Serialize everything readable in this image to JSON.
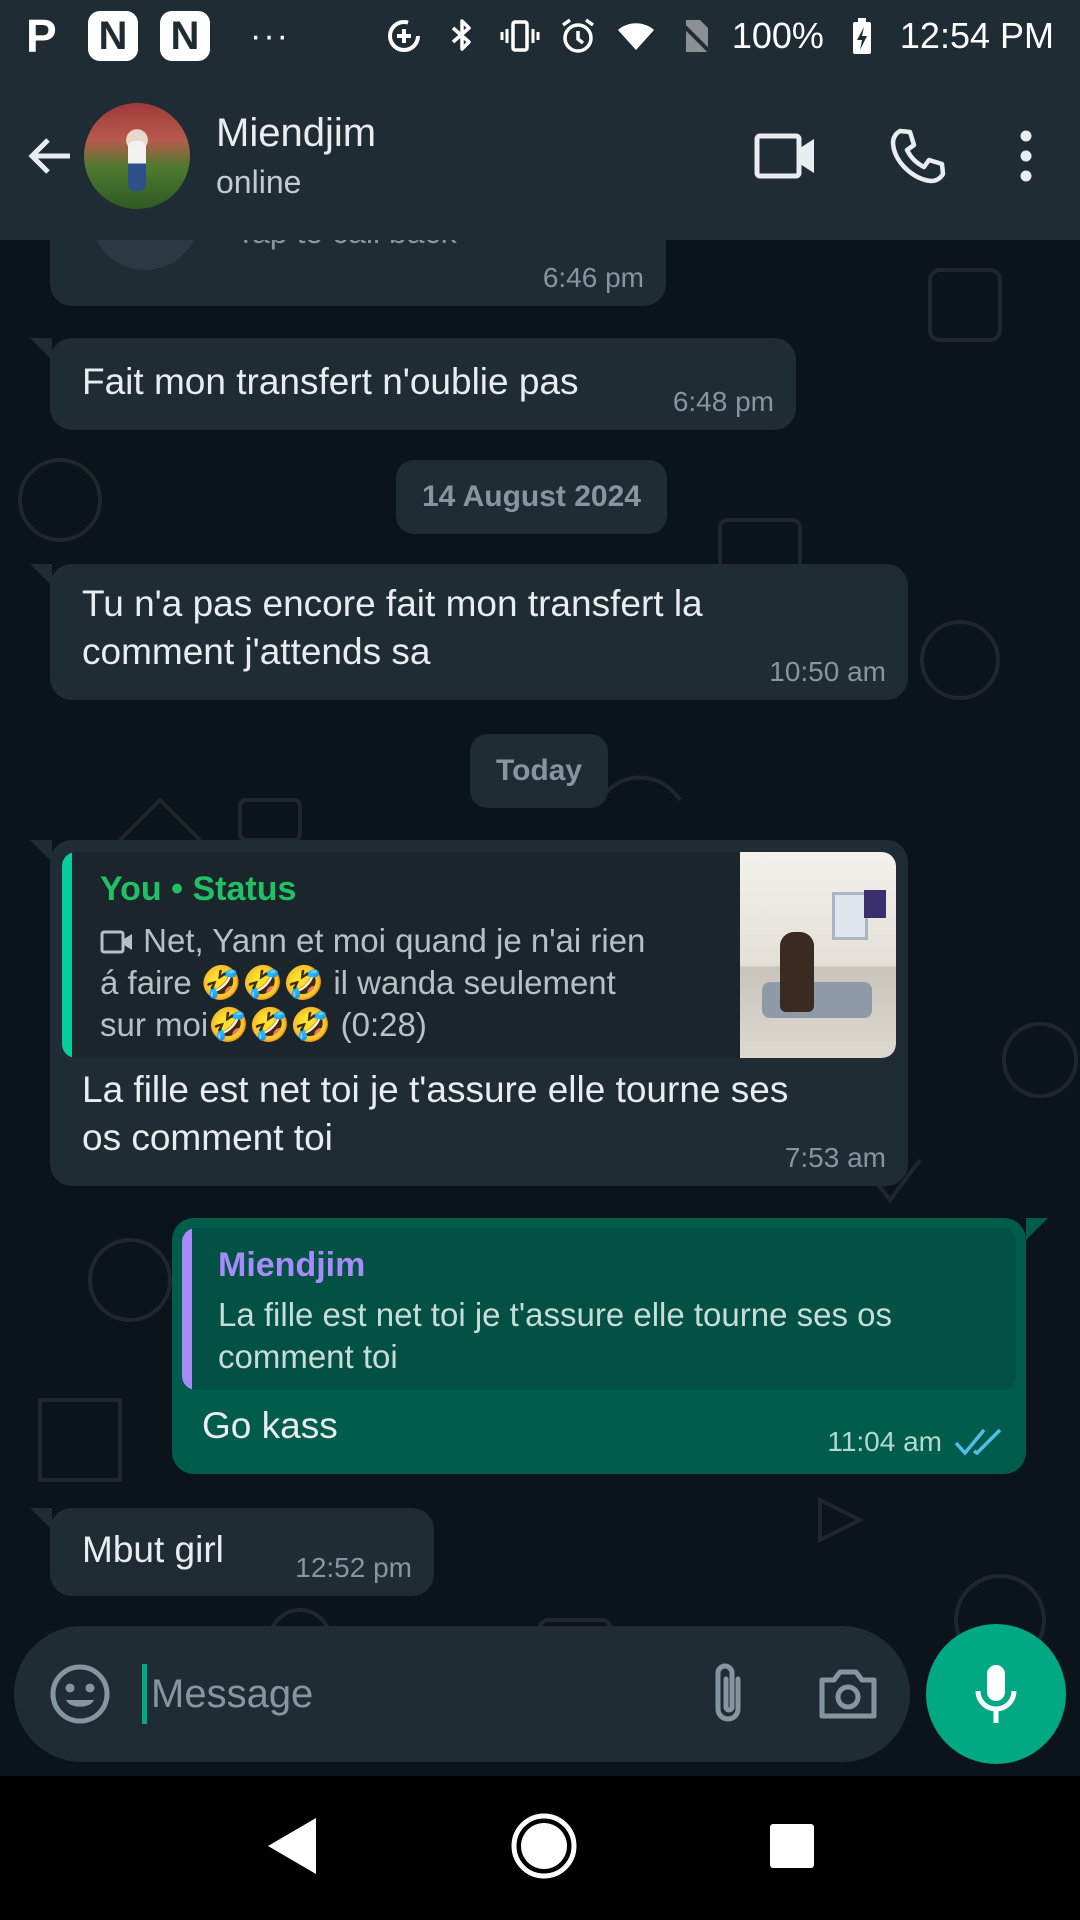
{
  "status_bar": {
    "app_icons": [
      "P",
      "N",
      "N"
    ],
    "more": "···",
    "battery": "100%",
    "time": "12:54 PM"
  },
  "header": {
    "contact_name": "Miendjim",
    "contact_status": "online"
  },
  "messages": {
    "m0_time": "6:46 pm",
    "m0_partial": "Tap to call back",
    "m1_text": "Fait mon transfert n'oublie pas",
    "m1_time": "6:48 pm",
    "date1": "14 August 2024",
    "m2_text_line1": "Tu n'a pas encore fait mon transfert la",
    "m2_text_line2": "comment j'attends sa",
    "m2_time": "10:50 am",
    "date2": "Today",
    "m3_quote_name": "You • Status",
    "m3_quote_line1": "Net, Yann  et moi quand je n'ai rien",
    "m3_quote_line2": "á faire 🤣🤣🤣 il wanda seulement",
    "m3_quote_line3": "sur moi🤣🤣🤣 (0:28)",
    "m3_text_line1": "La fille est net toi je t'assure elle tourne ses",
    "m3_text_line2": "os comment toi",
    "m3_time": "7:53 am",
    "m4_quote_name": "Miendjim",
    "m4_quote_line1": "La fille est net toi je t'assure elle tourne ses os",
    "m4_quote_line2": "comment toi",
    "m4_text": "Go kass",
    "m4_time": "11:04 am",
    "m5_text": "Mbut girl",
    "m5_time": "12:52 pm"
  },
  "input": {
    "placeholder": "Message"
  },
  "colors": {
    "header_bg": "#202c33",
    "chat_bg": "#0b141a",
    "incoming_bubble": "#202c33",
    "outgoing_bubble": "#005c4b",
    "accent": "#00a884",
    "status_quote_name": "#21c063",
    "reply_quote_name": "#a78bfa",
    "read_ticks": "#53bdeb"
  },
  "icons": [
    "back-arrow-icon",
    "video-call-icon",
    "voice-call-icon",
    "more-vert-icon",
    "emoji-icon",
    "attach-icon",
    "camera-icon",
    "mic-icon",
    "video-icon",
    "double-check-icon",
    "nav-back-icon",
    "nav-home-icon",
    "nav-recents-icon"
  ]
}
